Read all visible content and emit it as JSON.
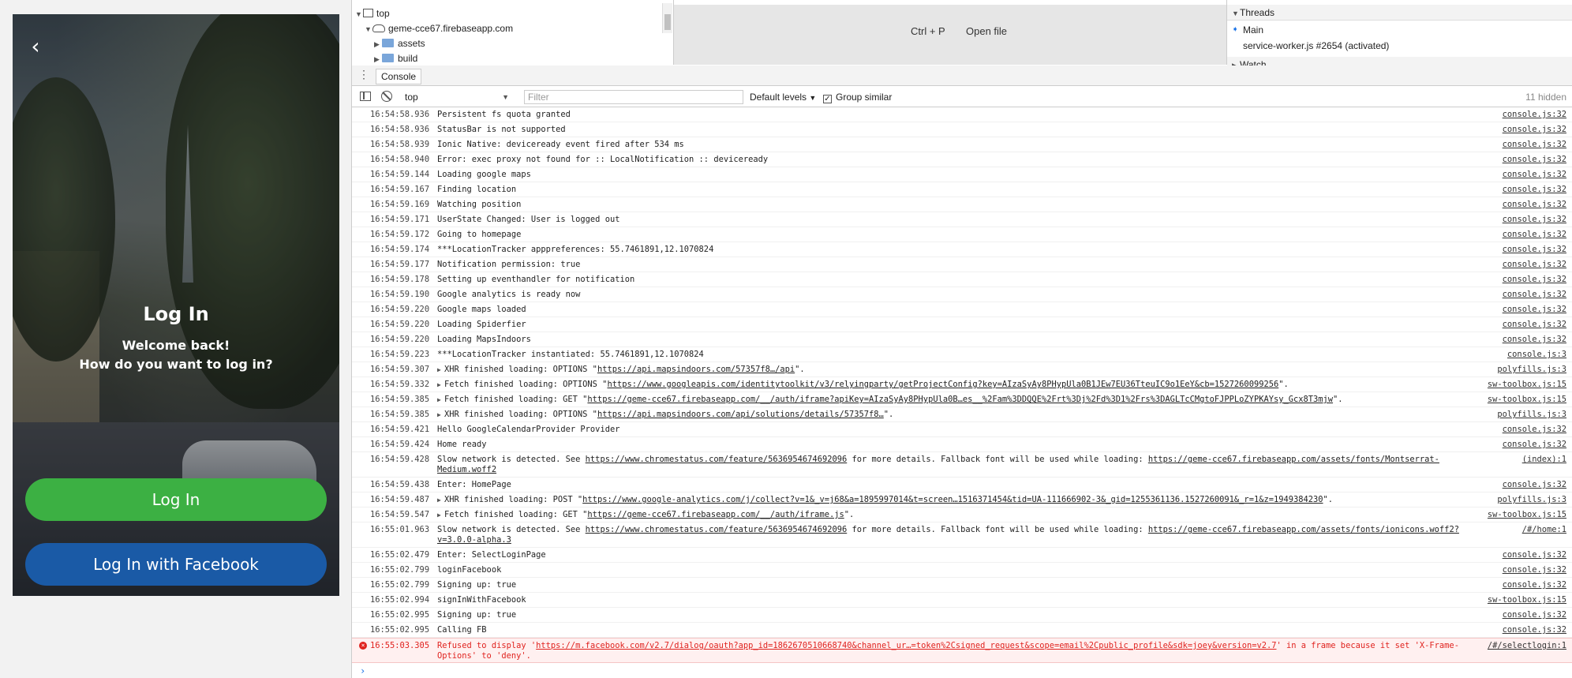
{
  "app": {
    "back_glyph": "‹",
    "title": "Log In",
    "welcome": "Welcome back!",
    "prompt": "How do you want to log in?",
    "login_button": "Log In",
    "facebook_button": "Log In with Facebook",
    "colors": {
      "login": "#3cb043",
      "facebook": "#1a5aa6"
    }
  },
  "devtools": {
    "sources_tree": [
      {
        "label": "top",
        "icon": "frame-icon",
        "expanded": true
      },
      {
        "label": "geme-cce67.firebaseapp.com",
        "icon": "cloud-icon",
        "expanded": true
      },
      {
        "label": "assets",
        "icon": "folder-icon",
        "expanded": false
      },
      {
        "label": "build",
        "icon": "folder-icon",
        "expanded": false
      }
    ],
    "editor": {
      "shortcut": "Ctrl + P",
      "shortcut_label": "Open file"
    },
    "threads": {
      "header": "Threads",
      "main": "Main",
      "worker": "service-worker.js #2654 (activated)",
      "watch": "Watch"
    },
    "drawer": {
      "menu_glyph": "⋮",
      "tab": "Console"
    },
    "toolbar": {
      "context": "top",
      "filter_placeholder": "Filter",
      "levels": "Default levels",
      "group_similar": "Group similar",
      "hidden": "11 hidden"
    },
    "log": [
      {
        "ts": "16:54:58.936",
        "msg": "Persistent fs quota granted",
        "src": "console.js:32"
      },
      {
        "ts": "16:54:58.936",
        "msg": "StatusBar is not supported",
        "src": "console.js:32"
      },
      {
        "ts": "16:54:58.939",
        "msg": "Ionic Native: deviceready event fired after 534 ms",
        "src": "console.js:32"
      },
      {
        "ts": "16:54:58.940",
        "msg": "Error: exec proxy not found for :: LocalNotification :: deviceready",
        "src": "console.js:32"
      },
      {
        "ts": "16:54:59.144",
        "msg": "Loading google maps",
        "src": "console.js:32"
      },
      {
        "ts": "16:54:59.167",
        "msg": "Finding location",
        "src": "console.js:32"
      },
      {
        "ts": "16:54:59.169",
        "msg": "Watching position",
        "src": "console.js:32"
      },
      {
        "ts": "16:54:59.171",
        "msg": "UserState Changed: User is logged out",
        "src": "console.js:32"
      },
      {
        "ts": "16:54:59.172",
        "msg": "Going to homepage",
        "src": "console.js:32"
      },
      {
        "ts": "16:54:59.174",
        "msg": "***LocationTracker apppreferences:  55.7461891,12.1070824",
        "src": "console.js:32"
      },
      {
        "ts": "16:54:59.177",
        "msg": "Notification permission: true",
        "src": "console.js:32"
      },
      {
        "ts": "16:54:59.178",
        "msg": "Setting up eventhandler for notification",
        "src": "console.js:32"
      },
      {
        "ts": "16:54:59.190",
        "msg": "Google analytics is ready now",
        "src": "console.js:32"
      },
      {
        "ts": "16:54:59.220",
        "msg": "Google maps loaded",
        "src": "console.js:32"
      },
      {
        "ts": "16:54:59.220",
        "msg": "Loading Spiderfier",
        "src": "console.js:32"
      },
      {
        "ts": "16:54:59.220",
        "msg": "Loading MapsIndoors",
        "src": "console.js:32"
      },
      {
        "ts": "16:54:59.223",
        "msg": "***LocationTracker instantiated:  55.7461891,12.1070824",
        "src": "console.js:3"
      },
      {
        "ts": "16:54:59.307",
        "pre": "XHR finished loading: OPTIONS \"",
        "link": "https://api.mapsindoors.com/57357f8…/api",
        "post": "\".",
        "src": "polyfills.js:3",
        "expand": true
      },
      {
        "ts": "16:54:59.332",
        "pre": "Fetch finished loading: OPTIONS \"",
        "link": "https://www.googleapis.com/identitytoolkit/v3/relyingparty/getProjectConfig?key=AIzaSyAy8PHypUla0B1JEw7EU36TteuIC9o1EeY&cb=1527260099256",
        "post": "\".",
        "src": "sw-toolbox.js:15",
        "expand": true
      },
      {
        "ts": "16:54:59.385",
        "pre": "Fetch finished loading: GET \"",
        "link": "https://geme-cce67.firebaseapp.com/__/auth/iframe?apiKey=AIzaSyAy8PHypUla0B…es__%2Fam%3DDQQE%2Frt%3Dj%2Fd%3D1%2Frs%3DAGLTcCMgtoFJPPLoZYPKAYsy_Gcx8T3mjw",
        "post": "\".",
        "src": "sw-toolbox.js:15",
        "expand": true
      },
      {
        "ts": "16:54:59.385",
        "pre": "XHR finished loading: OPTIONS \"",
        "link": "https://api.mapsindoors.com/api/solutions/details/57357f8…",
        "post": "\".",
        "src": "polyfills.js:3",
        "expand": true
      },
      {
        "ts": "16:54:59.421",
        "msg": "Hello GoogleCalendarProvider Provider",
        "src": "console.js:32"
      },
      {
        "ts": "16:54:59.424",
        "msg": "Home ready",
        "src": "console.js:32"
      },
      {
        "ts": "16:54:59.428",
        "pre": "Slow network is detected. See ",
        "link": "https://www.chromestatus.com/feature/5636954674692096",
        "post": " for more details. Fallback font will be used while loading: ",
        "link2": "https://geme-cce67.firebaseapp.com/assets/fonts/Montserrat-Medium.woff2",
        "src": "(index):1",
        "tall": true
      },
      {
        "ts": "16:54:59.438",
        "msg": "Enter: HomePage",
        "src": "console.js:32"
      },
      {
        "ts": "16:54:59.487",
        "pre": "XHR finished loading: POST \"",
        "link": "https://www.google-analytics.com/j/collect?v=1&_v=j68&a=1895997014&t=screen…1516371454&tid=UA-111666902-3&_gid=1255361136.1527260091&_r=1&z=1949384230",
        "post": "\".",
        "src": "polyfills.js:3",
        "expand": true
      },
      {
        "ts": "16:54:59.547",
        "pre": "Fetch finished loading: GET \"",
        "link": "https://geme-cce67.firebaseapp.com/__/auth/iframe.js",
        "post": "\".",
        "src": "sw-toolbox.js:15",
        "expand": true
      },
      {
        "ts": "16:55:01.963",
        "pre": "Slow network is detected. See ",
        "link": "https://www.chromestatus.com/feature/5636954674692096",
        "post": " for more details. Fallback font will be used while loading: ",
        "link2": "https://geme-cce67.firebaseapp.com/assets/fonts/ionicons.woff2?v=3.0.0-alpha.3",
        "src": "/#/home:1",
        "tall": true
      },
      {
        "ts": "16:55:02.479",
        "msg": "Enter: SelectLoginPage",
        "src": "console.js:32"
      },
      {
        "ts": "16:55:02.799",
        "msg": "loginFacebook",
        "src": "console.js:32"
      },
      {
        "ts": "16:55:02.799",
        "msg": "Signing up: true",
        "src": "console.js:32"
      },
      {
        "ts": "16:55:02.994",
        "msg": "signInWithFacebook",
        "src": "sw-toolbox.js:15"
      },
      {
        "ts": "16:55:02.995",
        "msg": "Signing up: true",
        "src": "console.js:32"
      },
      {
        "ts": "16:55:02.995",
        "msg": "Calling FB",
        "src": "console.js:32"
      },
      {
        "ts": "16:55:03.305",
        "pre": "Refused to display '",
        "link": "https://m.facebook.com/v2.7/dialog/oauth?app_id=1862670510668740&channel_ur…=token%2Csigned_request&scope=email%2Cpublic_profile&sdk=joey&version=v2.7",
        "post": "' in a frame because it set 'X-Frame-Options' to 'deny'.",
        "src": "/#/selectlogin:1",
        "error": true,
        "tall": true
      }
    ],
    "prompt": "›",
    "error_color": "#e0231f"
  }
}
